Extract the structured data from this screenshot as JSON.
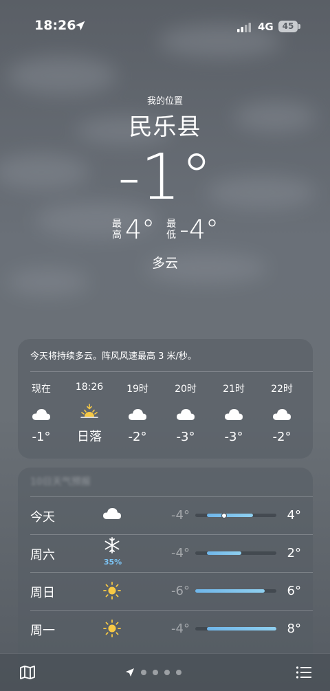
{
  "status_bar": {
    "time": "18:26",
    "network": "4G",
    "battery": "45"
  },
  "location": {
    "my_location_label": "我的位置",
    "city": "民乐县"
  },
  "current": {
    "temperature": "-1°",
    "high_label": "最\n高",
    "high": "4°",
    "low_label": "最\n低",
    "low": "-4°",
    "condition": "多云"
  },
  "hourly": {
    "summary": "今天将持续多云。阵风风速最高 3 米/秒。",
    "items": [
      {
        "label": "现在",
        "icon": "cloud-icon",
        "temp": "-1°"
      },
      {
        "label": "18:26",
        "icon": "sunset-icon",
        "temp": "日落"
      },
      {
        "label": "19时",
        "icon": "cloud-icon",
        "temp": "-2°"
      },
      {
        "label": "20时",
        "icon": "cloud-icon",
        "temp": "-3°"
      },
      {
        "label": "21时",
        "icon": "cloud-icon",
        "temp": "-3°"
      },
      {
        "label": "22时",
        "icon": "cloud-icon",
        "temp": "-2°"
      }
    ]
  },
  "daily": {
    "title": "10日天气预报",
    "range_min": -6,
    "range_max": 8,
    "items": [
      {
        "day": "今天",
        "icon": "cloud-icon",
        "precip": "",
        "low": "-4°",
        "high": "4°",
        "low_val": -4,
        "high_val": 4,
        "current": -1
      },
      {
        "day": "周六",
        "icon": "snowflake-icon",
        "precip": "35%",
        "low": "-4°",
        "high": "2°",
        "low_val": -4,
        "high_val": 2
      },
      {
        "day": "周日",
        "icon": "sun-icon",
        "precip": "",
        "low": "-6°",
        "high": "6°",
        "low_val": -6,
        "high_val": 6
      },
      {
        "day": "周一",
        "icon": "sun-icon",
        "precip": "",
        "low": "-4°",
        "high": "8°",
        "low_val": -4,
        "high_val": 8
      }
    ]
  },
  "colors": {
    "precip": "#7cc4f5",
    "sun": "#f7c945",
    "bar_start": "#6fb6ea",
    "bar_end": "#8fd0f0"
  },
  "bottom_bar": {
    "left_icon": "map-icon",
    "right_icon": "list-icon",
    "page_count": 5,
    "current_page": 0
  }
}
